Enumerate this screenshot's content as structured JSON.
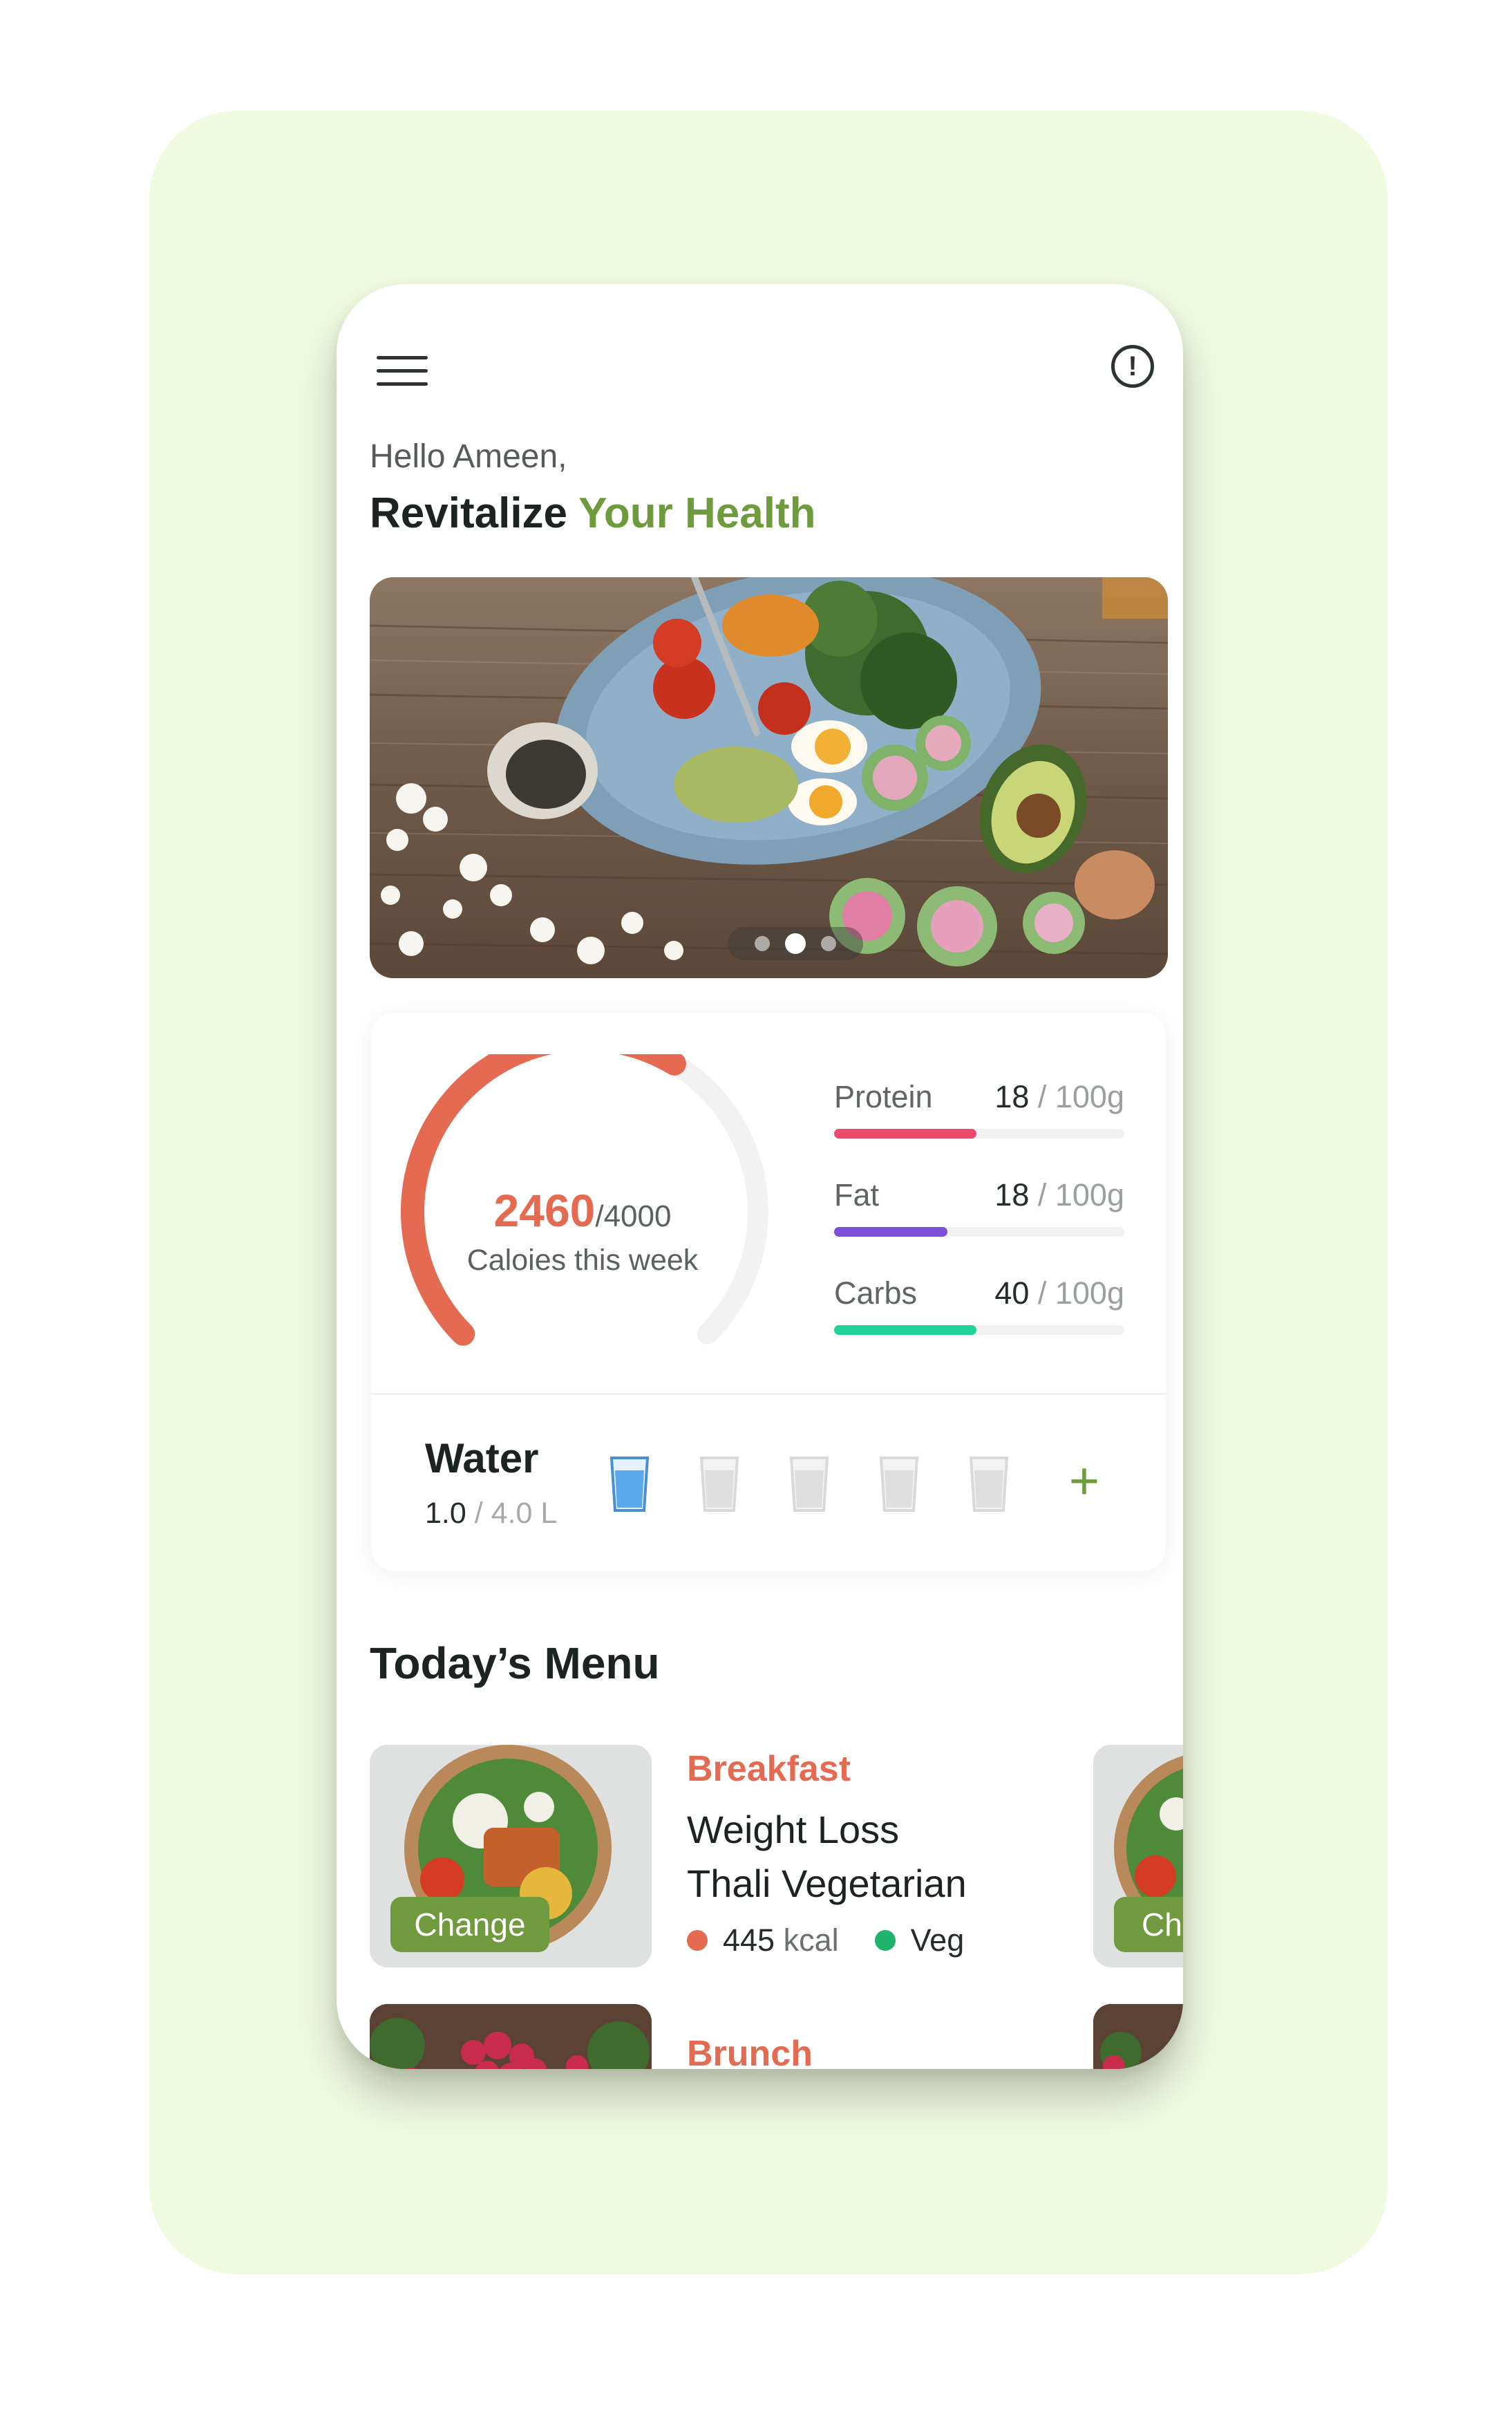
{
  "header": {
    "greeting": "Hello Ameen,",
    "headline_main": "Revitalize",
    "headline_accent": "Your Health",
    "menu_icon": "hamburger-menu-icon",
    "info_icon": "info-circle-icon"
  },
  "hero": {
    "image": "food-plate-photo",
    "slides_total": 3,
    "active_slide": 2
  },
  "calories": {
    "current": "2460",
    "total": "/4000",
    "label": "Caloies this week",
    "fraction": 0.615,
    "color": "#e46a51"
  },
  "macros": [
    {
      "name": "Protein",
      "current": "18",
      "total": " / 100g",
      "fraction": 0.49,
      "color": "#ec4a6e"
    },
    {
      "name": "Fat",
      "current": "18",
      "total": " / 100g",
      "fraction": 0.39,
      "color": "#7b4fd6"
    },
    {
      "name": "Carbs",
      "current": "40",
      "total": " / 100g",
      "fraction": 0.49,
      "color": "#1fd39a"
    }
  ],
  "water": {
    "title": "Water",
    "current": "1.0",
    "total": " / 4.0 L",
    "glasses_total": 5,
    "glasses_filled": 1,
    "add_icon": "plus-icon"
  },
  "menu": {
    "section_title": "Today’s Menu",
    "meals": [
      {
        "type": "Breakfast",
        "name_line1": "Weight Loss",
        "name_line2": "Thali Vegetarian",
        "kcal_value": "445",
        "kcal_unit": "kcal",
        "diet": "Veg",
        "change_label": "Change",
        "kcal_dot_color": "#e46a51",
        "diet_dot_color": "#1eb46b"
      },
      {
        "type": "Brunch"
      }
    ],
    "side_card_change_label": "Ch"
  },
  "colors": {
    "accent_green": "#6e9b3d",
    "accent_coral": "#e46a51",
    "background": "#f0fadf"
  }
}
